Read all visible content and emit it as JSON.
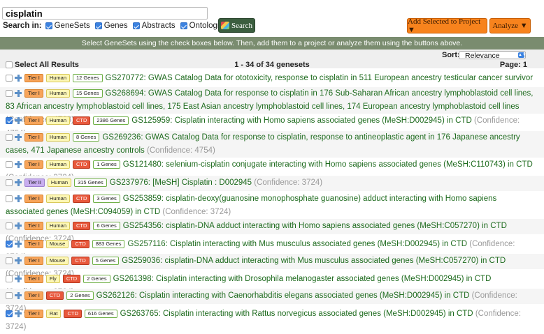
{
  "search": {
    "query": "cisplatin",
    "search_in_label": "Search in:",
    "options": [
      {
        "label": "GeneSets",
        "checked": true
      },
      {
        "label": "Genes",
        "checked": true
      },
      {
        "label": "Abstracts",
        "checked": true
      },
      {
        "label": "Ontologies",
        "checked": true
      }
    ],
    "button_label": "Search"
  },
  "actions": {
    "add_to_project": "Add Selected to Project ▼",
    "analyze": "Analyze ▼"
  },
  "banner": "Select GeneSets using the check boxes below. Then, add them to a project or analyze them using the buttons above.",
  "controls": {
    "select_all": "Select All Results",
    "result_count": "1 - 34 of 34 genesets",
    "sort_label": "Sort:",
    "sort_value": "Relevance",
    "page": "Page: 1"
  },
  "results": [
    {
      "checked": false,
      "tier": "Tier I",
      "tier_class": "tier1",
      "species": "Human",
      "ctd": false,
      "genes": "12 Genes",
      "id": "GS270772:",
      "title": "GWAS Catalog Data for ototoxicity, response to cisplatin in 511 European ancestry testicular cancer survivor individuals",
      "confidence": "(Confidence: 5768)"
    },
    {
      "checked": false,
      "tier": "Tier I",
      "tier_class": "tier1",
      "species": "Human",
      "ctd": false,
      "genes": "15 Genes",
      "id": "GS268694:",
      "title": "GWAS Catalog Data for response to cisplatin in 176 Sub-Saharan African ancestry lymphoblastoid cell lines, 83 African ancestry lymphoblastoid cell lines, 175 East Asian ancestry lymphoblastoid cell lines, 174 European ancestry lymphoblastoid cell lines",
      "confidence": "(Confidence: 4768)"
    },
    {
      "checked": true,
      "tier": "Tier I",
      "tier_class": "tier1",
      "species": "Human",
      "ctd": true,
      "genes": "2386 Genes",
      "id": "GS125959:",
      "title": "Cisplatin interacting with Homo sapiens associated genes (MeSH:D002945) in CTD",
      "confidence": "(Confidence: 4754)"
    },
    {
      "checked": false,
      "tier": "Tier I",
      "tier_class": "tier1",
      "species": "Human",
      "ctd": false,
      "genes": "8 Genes",
      "id": "GS269236:",
      "title": "GWAS Catalog Data for response to cisplatin, response to antineoplastic agent in 176 Japanese ancestry cases, 471 Japanese ancestry controls",
      "confidence": "(Confidence: 4754)"
    },
    {
      "checked": false,
      "tier": "Tier I",
      "tier_class": "tier1",
      "species": "Human",
      "ctd": true,
      "genes": "1 Genes",
      "id": "GS121480:",
      "title": "selenium-cisplatin conjugate interacting with Homo sapiens associated genes (MeSH:C110743) in CTD",
      "confidence": "(Confidence: 3724)"
    },
    {
      "checked": false,
      "tier": "Tier II",
      "tier_class": "tier2",
      "species": "Human",
      "ctd": false,
      "genes": "315 Genes",
      "id": "GS237976:",
      "title": "[MeSH] Cisplatin : D002945",
      "confidence": "(Confidence: 3724)"
    },
    {
      "checked": false,
      "tier": "Tier I",
      "tier_class": "tier1",
      "species": "Human",
      "ctd": true,
      "genes": "3 Genes",
      "id": "GS253859:",
      "title": "cisplatin-deoxy(guanosine monophosphate guanosine) adduct interacting with Homo sapiens associated genes (MeSH:C094059) in CTD",
      "confidence": "(Confidence: 3724)"
    },
    {
      "checked": false,
      "tier": "Tier I",
      "tier_class": "tier1",
      "species": "Human",
      "ctd": true,
      "genes": "6 Genes",
      "id": "GS254356:",
      "title": "cisplatin-DNA adduct interacting with Homo sapiens associated genes (MeSH:C057270) in CTD",
      "confidence": "(Confidence: 3724)"
    },
    {
      "checked": true,
      "tier": "Tier I",
      "tier_class": "tier1",
      "species": "Mouse",
      "ctd": true,
      "genes": "883 Genes",
      "id": "GS257116:",
      "title": "Cisplatin interacting with Mus musculus associated genes (MeSH:D002945) in CTD",
      "confidence": "(Confidence: 3724)"
    },
    {
      "checked": false,
      "tier": "Tier I",
      "tier_class": "tier1",
      "species": "Mouse",
      "ctd": true,
      "genes": "5 Genes",
      "id": "GS259036:",
      "title": "cisplatin-DNA adduct interacting with Mus musculus associated genes (MeSH:C057270) in CTD",
      "confidence": "(Confidence: 3724)"
    },
    {
      "checked": false,
      "tier": "Tier I",
      "tier_class": "tier1",
      "species": "Fly",
      "ctd": true,
      "genes": "2 Genes",
      "id": "GS261398:",
      "title": "Cisplatin interacting with Drosophila melanogaster associated genes (MeSH:D002945) in CTD",
      "confidence": "(Confidence: 3724)"
    },
    {
      "checked": false,
      "tier": "Tier I",
      "tier_class": "tier1",
      "species": "",
      "ctd": true,
      "genes": "2 Genes",
      "id": "GS262126:",
      "title": "Cisplatin interacting with Caenorhabditis elegans associated genes (MeSH:D002945) in CTD",
      "confidence": "(Confidence: 3724)"
    },
    {
      "checked": true,
      "tier": "Tier I",
      "tier_class": "tier1",
      "species": "Rat",
      "ctd": true,
      "genes": "616 Genes",
      "id": "GS263765:",
      "title": "Cisplatin interacting with Rattus norvegicus associated genes (MeSH:D002945) in CTD",
      "confidence": "(Confidence: 3724)"
    }
  ],
  "colors": {
    "banner_bg": "#7a8c6f",
    "link_green": "#1e6b1e",
    "orange_button": "#f7831d",
    "search_button": "#3b5e3f",
    "checkbox_blue": "#3b82e0"
  }
}
